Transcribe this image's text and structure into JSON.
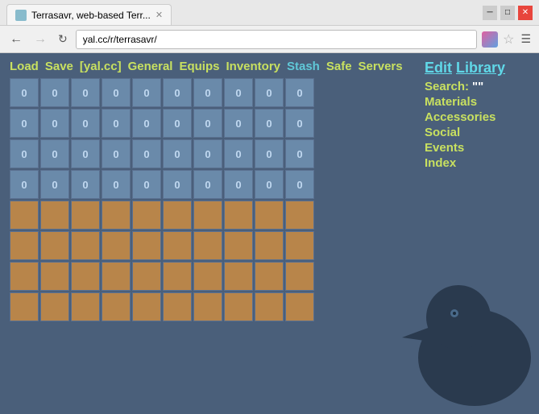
{
  "browser": {
    "tab_title": "Terrasavr, web-based Terr...",
    "url": "yal.cc/r/terrasavr/",
    "window_controls": {
      "minimize": "─",
      "maximize": "□",
      "close": "✕"
    }
  },
  "page": {
    "menu": {
      "items": [
        "Load",
        "Save",
        "[yal.cc]",
        "General",
        "Equips",
        "Inventory",
        "Stash",
        "Safe",
        "Servers"
      ]
    },
    "sidebar": {
      "title_edit": "Edit",
      "title_library": "Library",
      "search_label": "Search:",
      "search_value": "\"\"",
      "items": [
        "Materials",
        "Accessories",
        "Social",
        "Events",
        "Index"
      ]
    },
    "grid": {
      "blue_rows": 4,
      "brown_rows": 4,
      "cols": 10,
      "blue_value": "0",
      "brown_value": ""
    }
  }
}
